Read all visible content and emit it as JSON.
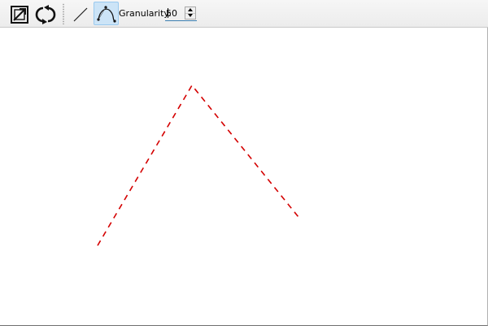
{
  "toolbar": {
    "icons": {
      "resize": "resize-arrow-icon",
      "refresh": "refresh-icon",
      "line": "line-tool-icon",
      "curve": "curve-tool-icon"
    },
    "active_tool": "curve",
    "granularity": {
      "label": "Granularity:",
      "value": "50"
    }
  },
  "canvas": {
    "stroke_color": "#d40000",
    "line_style": "dashed"
  }
}
